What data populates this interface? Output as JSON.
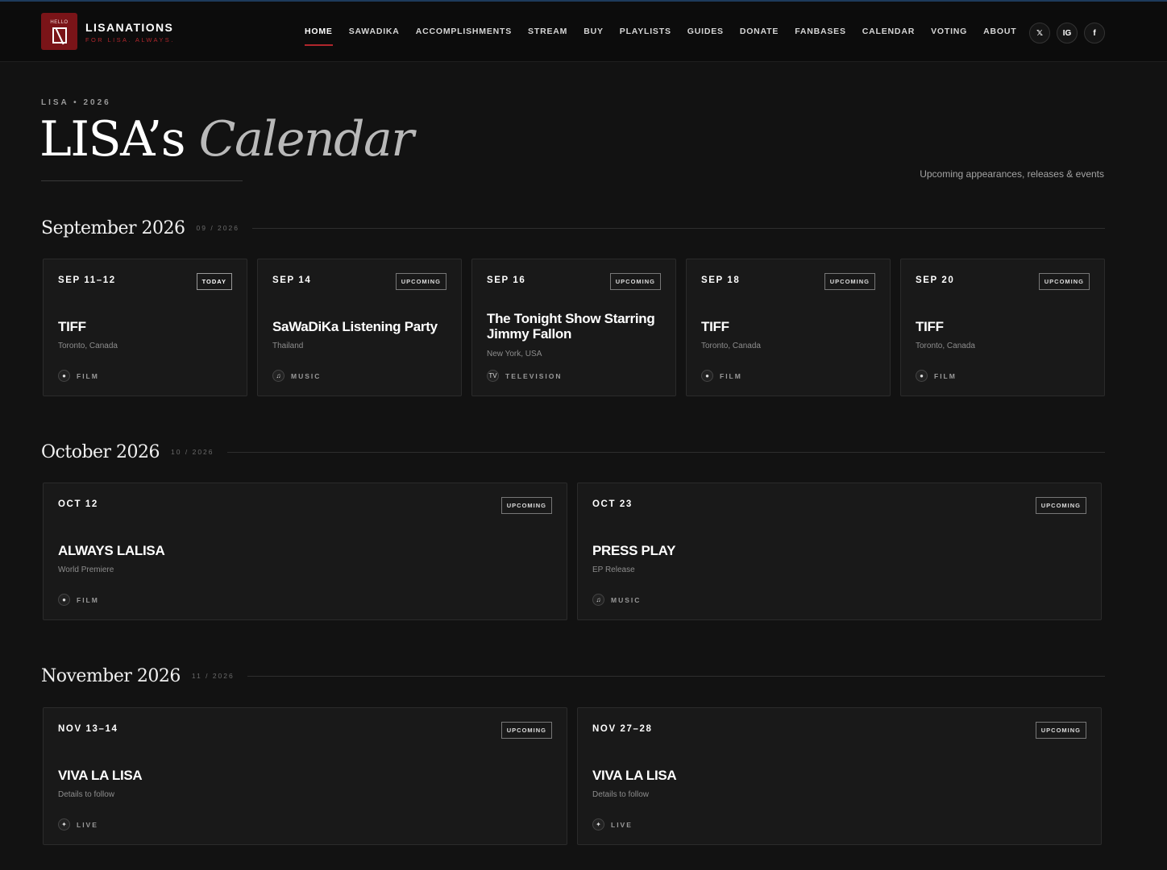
{
  "header": {
    "logo_text": "HELLO",
    "brand_name": "LISANATIONS",
    "brand_tagline": "FOR LISA. ALWAYS.",
    "nav": [
      {
        "label": "HOME",
        "active": true
      },
      {
        "label": "SAWADIKA"
      },
      {
        "label": "ACCOMPLISHMENTS"
      },
      {
        "label": "STREAM"
      },
      {
        "label": "BUY"
      },
      {
        "label": "PLAYLISTS"
      },
      {
        "label": "GUIDES"
      },
      {
        "label": "DONATE"
      },
      {
        "label": "FANBASES"
      },
      {
        "label": "CALENDAR"
      },
      {
        "label": "VOTING"
      },
      {
        "label": "ABOUT"
      }
    ],
    "social": [
      {
        "label": "𝕏",
        "icon": "x-icon"
      },
      {
        "label": "IG",
        "icon": "instagram-icon"
      },
      {
        "label": "f",
        "icon": "facebook-icon"
      }
    ]
  },
  "hero": {
    "eyebrow": "LISA • 2026",
    "title_main": "LISA’s",
    "title_italic": "Calendar",
    "subtitle": "Upcoming appearances, releases & events"
  },
  "months": [
    {
      "name": "September 2026",
      "num": "09 / 2026",
      "events": [
        {
          "date": "SEP 11–12",
          "badge": "TODAY",
          "title": "TIFF",
          "location": "Toronto, Canada",
          "category": "FILM",
          "icon": "film-icon",
          "glyph": "●"
        },
        {
          "date": "SEP 14",
          "badge": "UPCOMING",
          "title": "SaWaDiKa Listening Party",
          "location": "Thailand",
          "category": "MUSIC",
          "icon": "music-icon",
          "glyph": "♫"
        },
        {
          "date": "SEP 16",
          "badge": "UPCOMING",
          "title": "The Tonight Show Starring Jimmy Fallon",
          "location": "New York, USA",
          "category": "TELEVISION",
          "icon": "tv-icon",
          "glyph": "TV"
        },
        {
          "date": "SEP 18",
          "badge": "UPCOMING",
          "title": "TIFF",
          "location": "Toronto, Canada",
          "category": "FILM",
          "icon": "film-icon",
          "glyph": "●"
        },
        {
          "date": "SEP 20",
          "badge": "UPCOMING",
          "title": "TIFF",
          "location": "Toronto, Canada",
          "category": "FILM",
          "icon": "film-icon",
          "glyph": "●"
        }
      ]
    },
    {
      "name": "October 2026",
      "num": "10 / 2026",
      "events": [
        {
          "date": "OCT 12",
          "badge": "UPCOMING",
          "title": "ALWAYS LALISA",
          "location": "World Premiere",
          "category": "FILM",
          "icon": "film-icon",
          "glyph": "●"
        },
        {
          "date": "OCT 23",
          "badge": "UPCOMING",
          "title": "PRESS PLAY",
          "location": "EP Release",
          "category": "MUSIC",
          "icon": "music-icon",
          "glyph": "♫"
        }
      ]
    },
    {
      "name": "November 2026",
      "num": "11 / 2026",
      "events": [
        {
          "date": "NOV 13–14",
          "badge": "UPCOMING",
          "title": "VIVA LA LISA",
          "location": "Details to follow",
          "category": "LIVE",
          "icon": "sparkle-icon",
          "glyph": "✦"
        },
        {
          "date": "NOV 27–28",
          "badge": "UPCOMING",
          "title": "VIVA LA LISA",
          "location": "Details to follow",
          "category": "LIVE",
          "icon": "sparkle-icon",
          "glyph": "✦"
        }
      ]
    }
  ]
}
